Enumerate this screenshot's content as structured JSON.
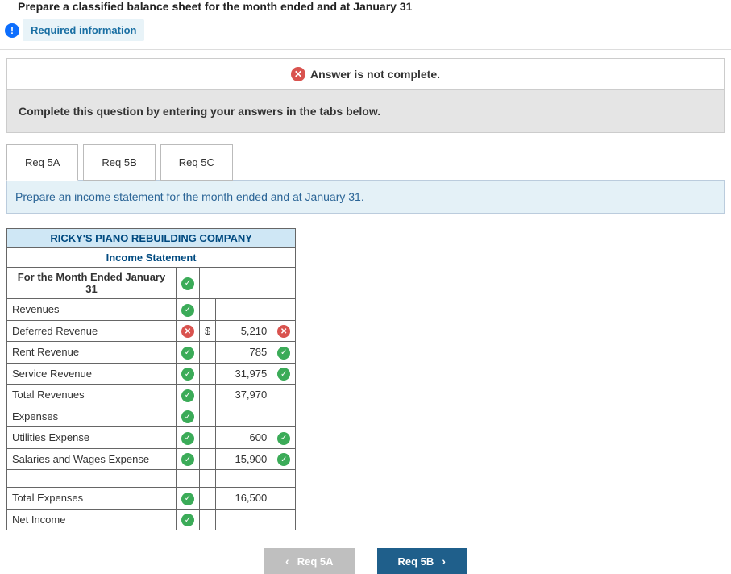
{
  "header": {
    "truncated_text": "Prepare a classified balance sheet for the month ended and at January 31",
    "required_info": "Required information"
  },
  "alert": {
    "text": "Answer is not complete."
  },
  "instruction": "Complete this question by entering your answers in the tabs below.",
  "tabs": [
    {
      "label": "Req 5A"
    },
    {
      "label": "Req 5B"
    },
    {
      "label": "Req 5C"
    }
  ],
  "prompt": "Prepare an income statement for the month ended and at January 31.",
  "worksheet": {
    "company": "RICKY'S PIANO REBUILDING COMPANY",
    "title": "Income Statement",
    "period": "For the Month Ended January 31",
    "rows": {
      "revenues_header": "Revenues",
      "deferred_revenue": {
        "label": "Deferred Revenue",
        "currency": "$",
        "value": "5,210"
      },
      "rent_revenue": {
        "label": "Rent Revenue",
        "value": "785"
      },
      "service_revenue": {
        "label": "Service Revenue",
        "value": "31,975"
      },
      "total_revenues": {
        "label": "Total Revenues",
        "value": "37,970"
      },
      "expenses_header": "Expenses",
      "utilities_expense": {
        "label": "Utilities Expense",
        "value": "600"
      },
      "salaries_expense": {
        "label": "Salaries and Wages Expense",
        "value": "15,900"
      },
      "total_expenses": {
        "label": "Total Expenses",
        "value": "16,500"
      },
      "net_income": {
        "label": "Net Income"
      }
    }
  },
  "nav": {
    "prev": "Req 5A",
    "next": "Req 5B"
  }
}
